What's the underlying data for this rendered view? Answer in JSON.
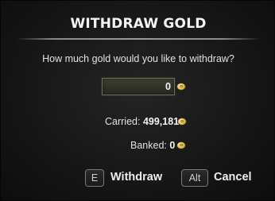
{
  "dialog": {
    "title": "WITHDRAW GOLD",
    "prompt": "How much gold would you like to withdraw?",
    "amount_value": "0",
    "carried_label": "Carried:",
    "carried_value": "499,181",
    "banked_label": "Banked:",
    "banked_value": "0",
    "currency_icon": "gold-coin-icon"
  },
  "actions": {
    "withdraw_key": "E",
    "withdraw_label": "Withdraw",
    "cancel_key": "Alt",
    "cancel_label": "Cancel"
  },
  "colors": {
    "background": "#1a1a1a",
    "text": "#e6e6e6",
    "input_border": "#6b7352",
    "gold": "#e8c45a"
  }
}
